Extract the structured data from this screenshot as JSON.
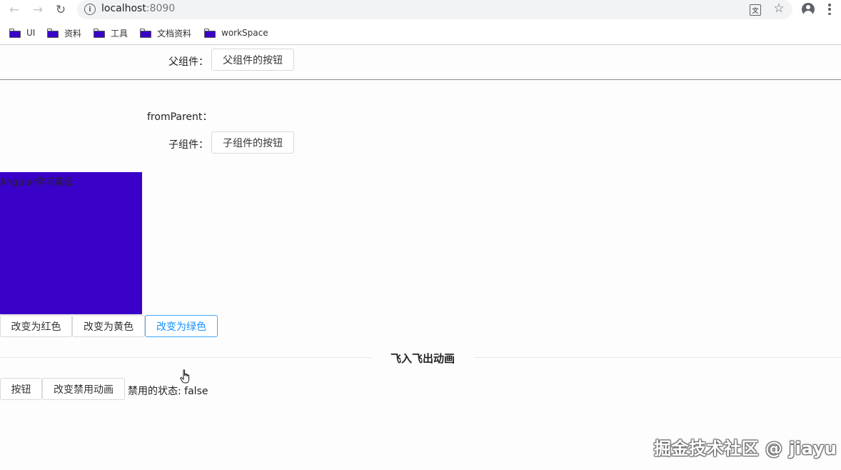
{
  "browser": {
    "url_host": "localhost",
    "url_port": ":8090",
    "bookmarks": [
      {
        "label": "UI"
      },
      {
        "label": "资料"
      },
      {
        "label": "工具"
      },
      {
        "label": "文档资料"
      },
      {
        "label": "workSpace"
      }
    ]
  },
  "parent": {
    "label": "父组件：",
    "button": "父组件的按钮"
  },
  "child": {
    "from_parent_label": "fromParent：",
    "label": "子组件：",
    "button": "子组件的按钮"
  },
  "color_box": {
    "text": "Angular学习笔记",
    "color": "#3a01c8"
  },
  "color_buttons": [
    {
      "label": "改变为红色",
      "active": false
    },
    {
      "label": "改变为黄色",
      "active": false
    },
    {
      "label": "改变为绿色",
      "active": true
    }
  ],
  "animation": {
    "title": "飞入飞出动画",
    "button": "按钮",
    "toggle_button": "改变禁用动画",
    "status_label": "禁用的状态: false"
  },
  "watermark": "掘金技术社区 @ jiayu",
  "colors": {
    "accent": "#1890ff",
    "box": "#3a01c8"
  }
}
